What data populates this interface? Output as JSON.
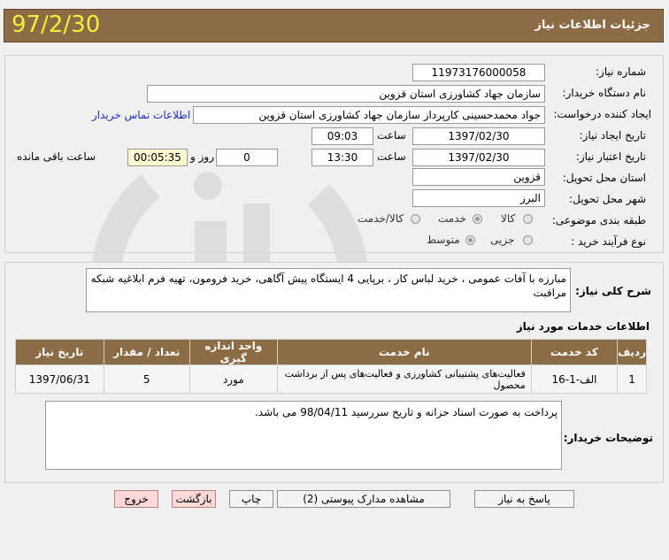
{
  "header": {
    "title": "جزئیات اطلاعات نیاز",
    "date": "97/2/30"
  },
  "form": {
    "need_number_label": "شماره نیاز:",
    "need_number": "1197317600005‎8",
    "buyer_org_label": "نام دستگاه خریدار:",
    "buyer_org": "سازمان جهاد کشاورزی استان قزوین",
    "creator_label": "ایجاد کننده درخواست:",
    "creator": "جواد محمدحسینی کارپرداز سازمان جهاد کشاورزی استان قزوین",
    "contact_link": "اطلاعات تماس خریدار",
    "created_date_label": "تاریخ ایجاد نیاز:",
    "created_date": "1397/02/30",
    "time_label": "ساعت",
    "created_time": "09:03",
    "valid_date_label": "تاریخ اعتبار نیاز:",
    "valid_date": "1397/02/30",
    "valid_time": "13:30",
    "days_value": "0",
    "days_label": "روز و",
    "remaining_time": "00:05:35",
    "remaining_label": "ساعت باقی مانده",
    "delivery_province_label": "استان محل تحویل:",
    "delivery_province": "قزوین",
    "delivery_city_label": "شهر محل تحویل:",
    "delivery_city": "البرز",
    "category_label": "طبقه بندی موضوعی:",
    "category_options": [
      "کالا",
      "خدمت",
      "کالا/خدمت"
    ],
    "category_selected": "خدمت",
    "purchase_type_label": "نوع فرآیند خرید :",
    "purchase_type_options": [
      "جزیی",
      "متوسط"
    ],
    "purchase_type_selected": "متوسط"
  },
  "description": {
    "label": "شرح کلی نیاز:",
    "text": "مبارزه با آفات عمومی ، خرید لباس کار ، برپایی 4 ایستگاه پیش آگاهی، خرید فرومون، تهیه فرم ابلاغیه شبکه مراقبت"
  },
  "services": {
    "title": "اطلاعات خدمات مورد نیاز",
    "columns": [
      "ردیف",
      "کد خدمت",
      "نام خدمت",
      "واحد اندازه گیری",
      "تعداد / مقدار",
      "تاریخ نیاز"
    ],
    "rows": [
      [
        "1",
        "الف-1-16",
        "فعالیت‌های پشتیبانی کشاورزی و فعالیت‌های پس از برداشت محصول",
        "مورد",
        "5",
        "1397/06/31"
      ]
    ]
  },
  "buyer_notes": {
    "label": "توضیحات خریدار:",
    "text": "پرداخت به صورت اسناد خزانه و تاریخ سررسید 98/04/11 می باشد."
  },
  "buttons": {
    "reply": "پاسخ به نیاز",
    "attachments": "مشاهده مدارک پیوستی (2)",
    "print": "چاپ",
    "back": "بازگشت",
    "exit": "خروج"
  }
}
